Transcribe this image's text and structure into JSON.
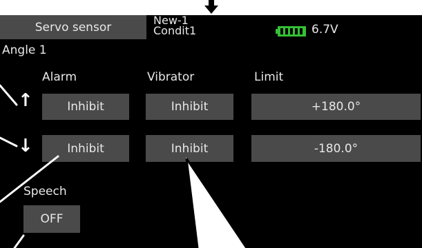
{
  "header": {
    "title": "Servo sensor",
    "model_name": "New-1",
    "condition": "Condit1",
    "battery_icon": "battery-full-icon",
    "battery_color": "#35c035",
    "voltage": "6.7V"
  },
  "section": {
    "label": "Angle 1"
  },
  "columns": {
    "alarm": "Alarm",
    "vibrator": "Vibrator",
    "limit": "Limit"
  },
  "rows": [
    {
      "direction_icon": "arrow-up-icon",
      "glyph": "↑",
      "alarm": "Inhibit",
      "vibrator": "Inhibit",
      "limit": "+180.0°"
    },
    {
      "direction_icon": "arrow-down-icon",
      "glyph": "↓",
      "alarm": "Inhibit",
      "vibrator": "Inhibit",
      "limit": "-180.0°"
    }
  ],
  "speech": {
    "label": "Speech",
    "value": "OFF"
  },
  "colors": {
    "screen": "#000000",
    "button": "#4a4a4a",
    "text": "#e8e8e8"
  }
}
